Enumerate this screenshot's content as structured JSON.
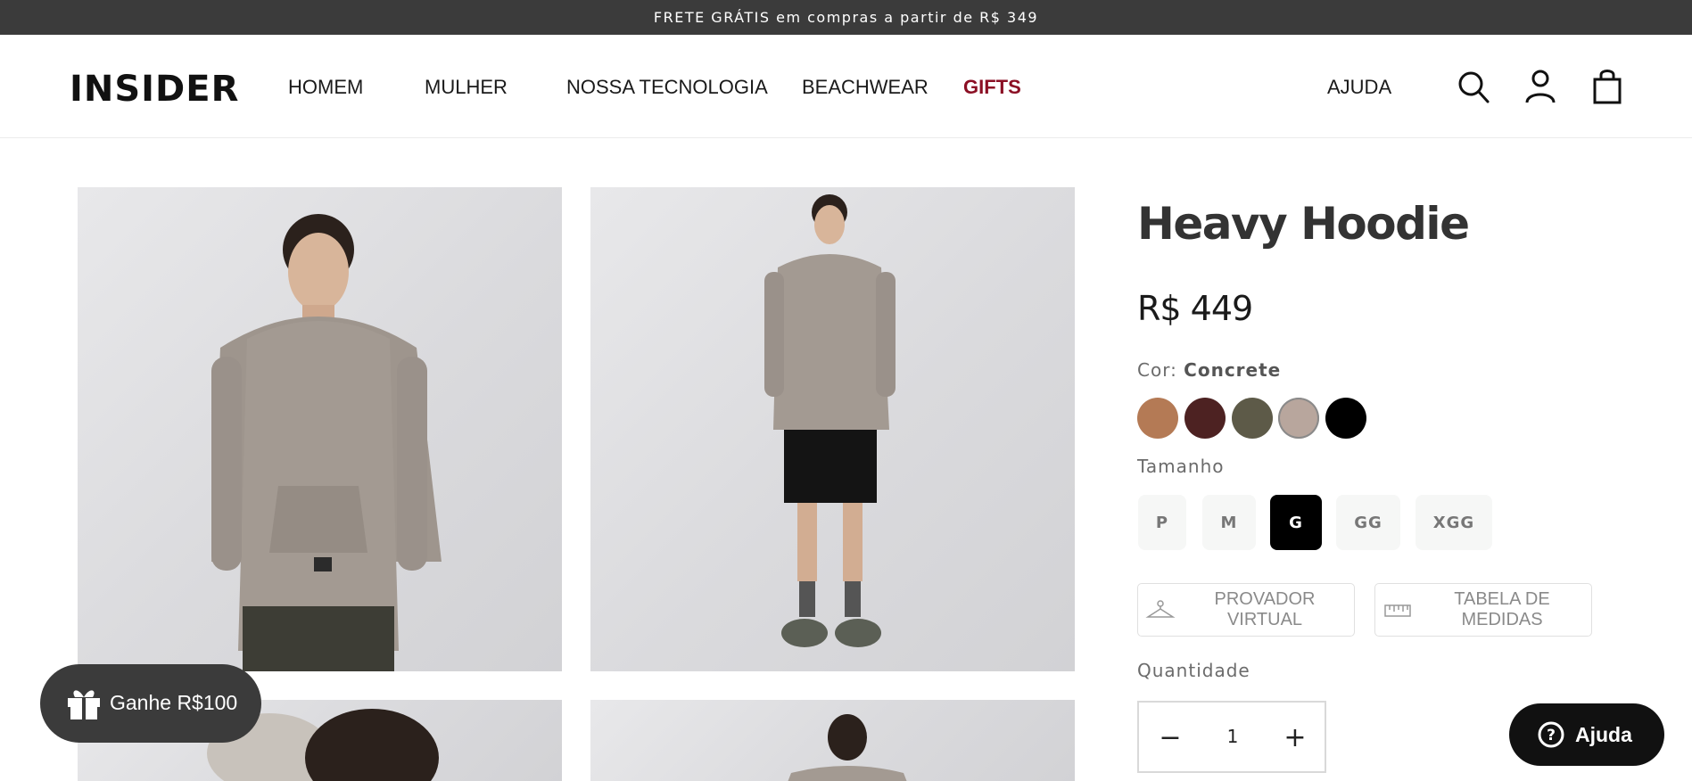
{
  "promo": {
    "text": "FRETE GRÁTIS em compras a partir de R$ 349"
  },
  "header": {
    "logo": "INSIDER",
    "nav": [
      "HOMEM",
      "MULHER",
      "NOSSA TECNOLOGIA",
      "BEACHWEAR",
      "GIFTS"
    ],
    "help": "AJUDA",
    "icons": [
      "search-icon",
      "account-icon",
      "bag-icon"
    ]
  },
  "product": {
    "title": "Heavy Hoodie",
    "price": "R$ 449",
    "color_label": "Cor:",
    "color_value": "Concrete",
    "swatches": [
      {
        "name": "caramel",
        "color": "#b47a55"
      },
      {
        "name": "burgundy",
        "color": "#4d2222"
      },
      {
        "name": "olive",
        "color": "#5d5a48"
      },
      {
        "name": "concrete",
        "color": "#b8a69d",
        "selected": true
      },
      {
        "name": "black",
        "color": "#000000"
      }
    ],
    "size_label": "Tamanho",
    "sizes": [
      "P",
      "M",
      "G",
      "GG",
      "XGG"
    ],
    "selected_size": "G",
    "virtual_fitting": "PROVADOR VIRTUAL",
    "size_chart": "TABELA DE MEDIDAS",
    "quantity_label": "Quantidade",
    "quantity": "1",
    "qty_minus": "−",
    "qty_plus": "+"
  },
  "colors": {
    "promo_bg": "#3b3b3b",
    "gifts": "#8b0f24",
    "selected_size_bg": "#000000"
  },
  "floating": {
    "gift": "Ganhe R$100",
    "help": "Ajuda"
  }
}
